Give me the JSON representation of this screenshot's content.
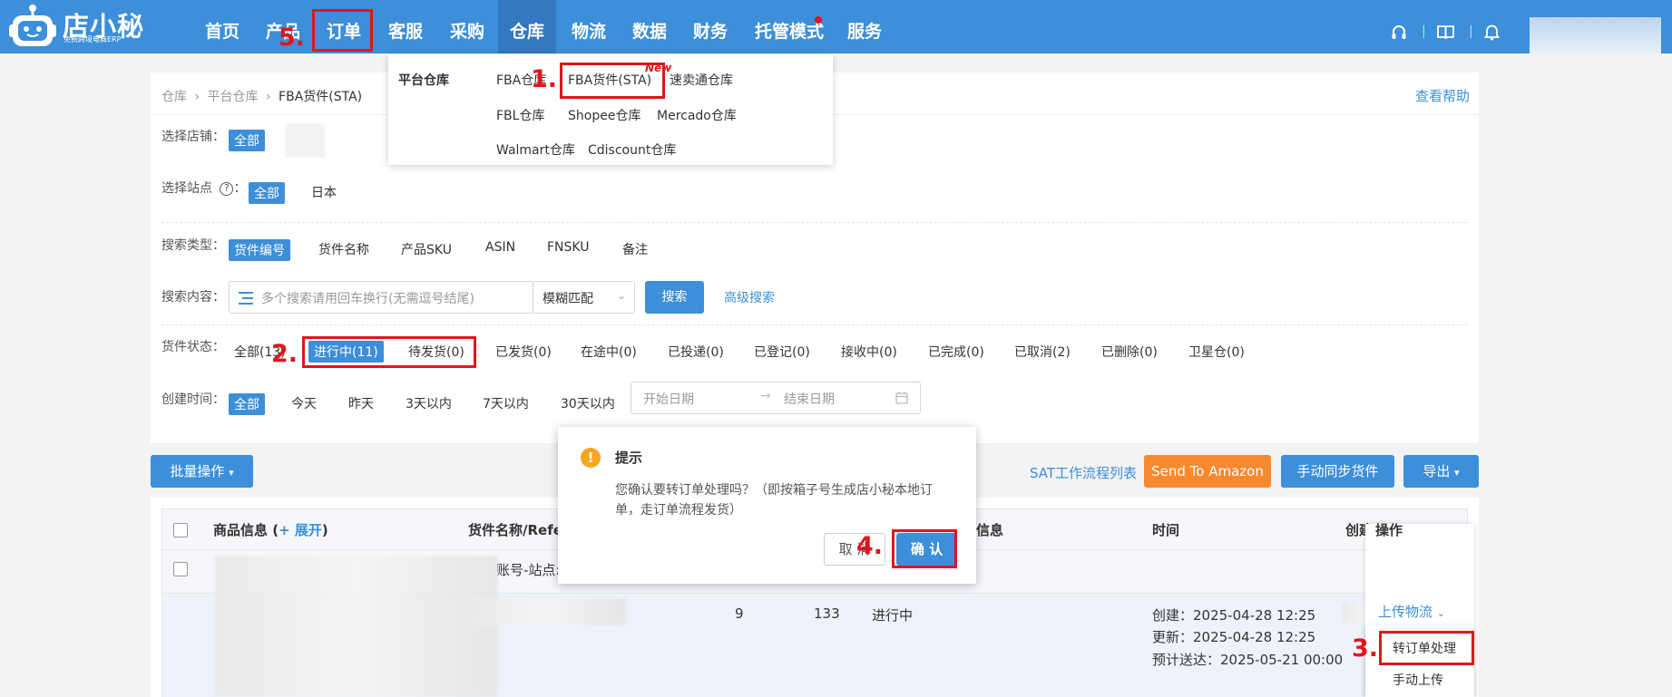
{
  "colors": {
    "primary": "#3c8fd8",
    "nav_active": "#3378c1",
    "annotation": "#e0151c",
    "orange": "#f7892f",
    "warning": "#f5a623"
  },
  "brand": {
    "name": "店小秘",
    "slogan": "免费跨境电商ERP"
  },
  "nav": {
    "items": [
      "首页",
      "产品",
      "订单",
      "客服",
      "采购",
      "仓库",
      "物流",
      "数据",
      "财务",
      "托管模式",
      "服务"
    ],
    "active": "仓库",
    "right_icons": [
      "headset-icon",
      "book-icon",
      "bell-icon"
    ]
  },
  "breadcrumb": {
    "items": [
      "仓库",
      "平台仓库",
      "FBA货件(STA)"
    ],
    "help_link": "查看帮助"
  },
  "filters": {
    "shop": {
      "label": "选择店铺：",
      "selected": "全部"
    },
    "site": {
      "label": "选择站点",
      "help_icon": "question-circle-icon",
      "selected": "全部",
      "options": [
        "日本"
      ]
    },
    "search_type": {
      "label": "搜索类型：",
      "selected": "货件编号",
      "options": [
        "货件名称",
        "产品SKU",
        "ASIN",
        "FNSKU",
        "备注"
      ]
    },
    "search_content": {
      "label": "搜索内容：",
      "placeholder": "多个搜索请用回车换行(无需逗号结尾)",
      "match_mode": "模糊匹配",
      "search_btn": "搜索",
      "advanced": "高级搜索"
    },
    "status": {
      "label": "货件状态：",
      "items": [
        "全部(13)",
        "进行中(11)",
        "待发货(0)",
        "已发货(0)",
        "在途中(0)",
        "已投递(0)",
        "已登记(0)",
        "接收中(0)",
        "已完成(0)",
        "已取消(2)",
        "已删除(0)",
        "卫星仓(0)"
      ],
      "selected": "进行中(11)"
    },
    "created_time": {
      "label": "创建时间：",
      "selected": "全部",
      "options": [
        "今天",
        "昨天",
        "3天以内",
        "7天以内",
        "30天以内"
      ],
      "start_placeholder": "开始日期",
      "end_placeholder": "结束日期"
    }
  },
  "toolbar": {
    "batch": "批量操作",
    "workflow_link": "SAT工作流程列表",
    "send_amazon": "Send To Amazon",
    "manual_sync": "手动同步货件",
    "export": "导出"
  },
  "table": {
    "headers": {
      "product": "商品信息",
      "expand": "+ 展开",
      "shipment_name": "货件名称/Refer",
      "info": "信息",
      "time": "时间",
      "creator": "创建",
      "action": "操作"
    },
    "group_label": "账号-站点:",
    "row": {
      "qty1": "9",
      "qty2": "133",
      "status": "进行中",
      "created": "创建：2025-04-28 12:25",
      "updated": "更新：2025-04-28 12:25",
      "eta": "预计送达：2025-05-21 00:00",
      "action_link": "上传物流"
    }
  },
  "dropdown": {
    "title": "平台仓库",
    "row1": [
      "FBA仓库",
      "FBA货件(STA)",
      "速卖通仓库"
    ],
    "row2": [
      "FBL仓库",
      "Shopee仓库",
      "Mercado仓库"
    ],
    "row3": [
      "Walmart仓库",
      "Cdiscount仓库"
    ],
    "new_badge": "New"
  },
  "dialog": {
    "title": "提示",
    "message_line1": "您确认要转订单处理吗？（即按箱子号生成店小秘本地订",
    "message_line2": "单，走订单流程发货）",
    "cancel": "取 消",
    "confirm": "确 认"
  },
  "action_menu": {
    "items": [
      "转订单处理",
      "手动上传"
    ]
  },
  "annotations": {
    "n1": "1.",
    "n2": "2.",
    "n3": "3.",
    "n4": "4.",
    "n5": "5."
  }
}
